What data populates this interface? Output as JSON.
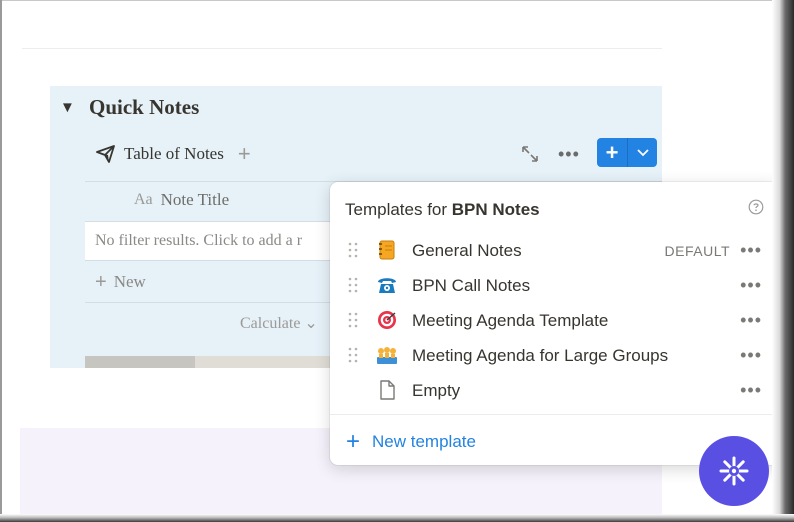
{
  "block": {
    "title": "Quick Notes",
    "view_name": "Table of Notes",
    "column_header": "Note Title",
    "empty_message": "No filter results. Click to add a r",
    "new_row_label": "New",
    "calculate_label": "Calculate",
    "add_view_label": "+",
    "view_more_label": "•••"
  },
  "new_button": {
    "plus": "+"
  },
  "icons": {
    "toggle": "triangle-down",
    "view": "paper-plane-icon",
    "expand": "expand-icon",
    "help": "help-circle-icon",
    "drag": "drag-handle-icon",
    "fab": "sparkle-icon"
  },
  "templates_popover": {
    "header_prefix": "Templates for ",
    "database_name": "BPN Notes",
    "items": [
      {
        "label": "General Notes",
        "icon": "notebook-icon",
        "badge": "DEFAULT",
        "more": "•••"
      },
      {
        "label": "BPN Call Notes",
        "icon": "telephone-icon",
        "badge": "",
        "more": "•••"
      },
      {
        "label": "Meeting Agenda Template",
        "icon": "target-icon",
        "badge": "",
        "more": "•••"
      },
      {
        "label": "Meeting Agenda for Large Groups",
        "icon": "group-icon",
        "badge": "",
        "more": "•••"
      },
      {
        "label": "Empty",
        "icon": "page-icon",
        "badge": "",
        "more": "•••"
      }
    ],
    "new_template_label": "New template"
  },
  "colors": {
    "accent": "#2383e2",
    "block_bg": "#e6f1f8",
    "fab": "#5a4fe3",
    "text": "#37352f"
  }
}
